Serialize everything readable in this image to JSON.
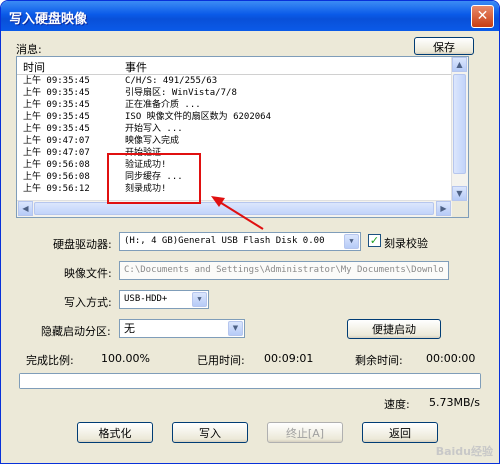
{
  "window": {
    "title": "写入硬盘映像",
    "close_glyph": "✕"
  },
  "messages_label": "消息:",
  "save_button": "保存",
  "log": {
    "headers": {
      "time": "时间",
      "event": "事件"
    },
    "rows": [
      {
        "time": "上午 09:35:45",
        "event": "C/H/S: 491/255/63"
      },
      {
        "time": "上午 09:35:45",
        "event": "引导扇区: WinVista/7/8"
      },
      {
        "time": "上午 09:35:45",
        "event": "正在准备介质 ..."
      },
      {
        "time": "上午 09:35:45",
        "event": "ISO 映像文件的扇区数为 6202064"
      },
      {
        "time": "上午 09:35:45",
        "event": "开始写入 ..."
      },
      {
        "time": "上午 09:47:07",
        "event": "映像写入完成"
      },
      {
        "time": "上午 09:47:07",
        "event": "开始验证"
      },
      {
        "time": "上午 09:56:08",
        "event": "验证成功!"
      },
      {
        "time": "上午 09:56:08",
        "event": "同步缓存 ..."
      },
      {
        "time": "上午 09:56:12",
        "event": "刻录成功!"
      }
    ]
  },
  "form": {
    "drive_label": "硬盘驱动器:",
    "drive_value": "(H:, 4 GB)General USB Flash Disk  0.00",
    "verify_label": "刻录校验",
    "verify_checked": true,
    "image_label": "映像文件:",
    "image_value": "C:\\Documents and Settings\\Administrator\\My Documents\\Downlo",
    "write_mode_label": "写入方式:",
    "write_mode_value": "USB-HDD+",
    "hidden_part_label": "隐藏启动分区:",
    "hidden_part_value": "无",
    "quick_boot_button": "便捷启动"
  },
  "status": {
    "complete_label": "完成比例:",
    "complete_value": "100.00%",
    "elapsed_label": "已用时间:",
    "elapsed_value": "00:09:01",
    "remaining_label": "剩余时间:",
    "remaining_value": "00:00:00",
    "progress_fraction": 1.0,
    "speed_label": "速度:",
    "speed_value": "5.73MB/s"
  },
  "buttons": {
    "format": "格式化",
    "write": "写入",
    "stop": "终止[A]",
    "back": "返回"
  },
  "watermark": "Baidu经验",
  "colors": {
    "annotation": "#e01010",
    "titlebar": "#0a5ae8"
  }
}
